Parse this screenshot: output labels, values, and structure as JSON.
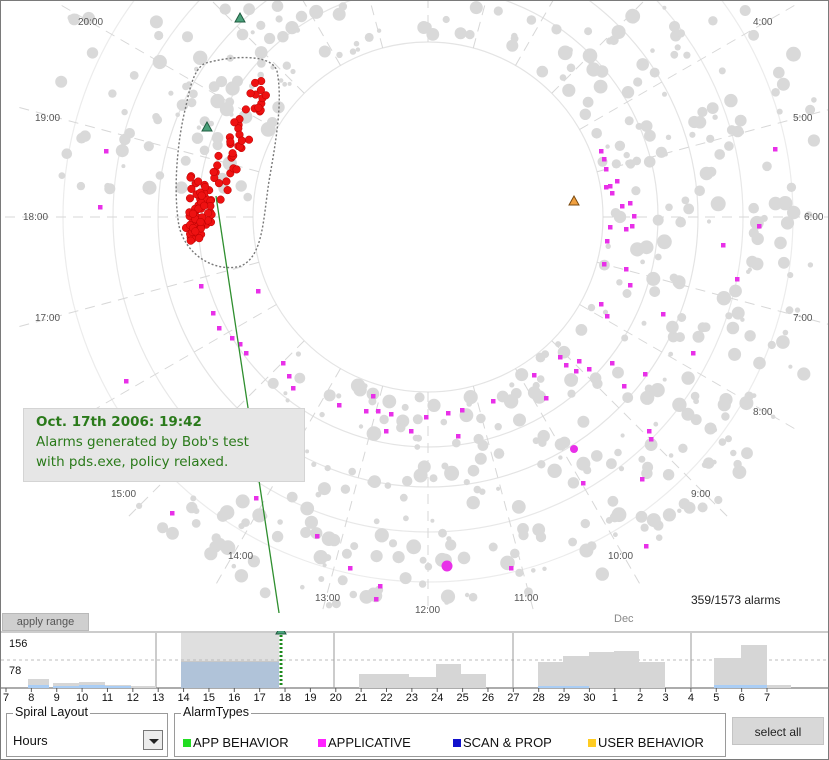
{
  "spiral": {
    "hour_labels": [
      "20:00",
      "4:00",
      "19:00",
      "5:00",
      "18:00",
      "6:00",
      "17:00",
      "7:00",
      "8:00",
      "15:00",
      "9:00",
      "14:00",
      "10:00",
      "13:00",
      "11:00",
      "12:00"
    ],
    "annotation": {
      "title": "Oct. 17th 2006: 19:42",
      "line1": "Alarms generated by Bob's test",
      "line2": "with pds.exe, policy relaxed."
    },
    "alarm_count": "359/1573 alarms",
    "month_label": "Dec",
    "apply_range_label": "apply range"
  },
  "timeline": {
    "y_labels": [
      "156",
      "78"
    ],
    "day_labels": [
      "7",
      "8",
      "9",
      "10",
      "11",
      "12",
      "13",
      "14",
      "15",
      "16",
      "17",
      "18",
      "19",
      "20",
      "21",
      "22",
      "23",
      "24",
      "25",
      "26",
      "27",
      "28",
      "29",
      "30",
      "1",
      "2",
      "3",
      "4",
      "5",
      "6",
      "7"
    ]
  },
  "controls": {
    "spiral_layout_title": "Spiral Layout",
    "spiral_layout_value": "Hours",
    "alarm_types_title": "AlarmTypes",
    "alarm_types": [
      {
        "label": "APP BEHAVIOR",
        "color": "#22dd22"
      },
      {
        "label": "APPLICATIVE",
        "color": "#ff22ff"
      },
      {
        "label": "SCAN & PROP",
        "color": "#1111cc"
      },
      {
        "label": "USER BEHAVIOR",
        "color": "#ffcc22"
      }
    ],
    "select_all_label": "select all"
  },
  "colors": {
    "app_behavior_alarm": "#ee1111",
    "applicative_alarm": "#e830e8",
    "background_alarm": "#d9d9d9",
    "annotation_text": "#2a7a1a",
    "range_highlight": "#a9cdf5"
  }
}
